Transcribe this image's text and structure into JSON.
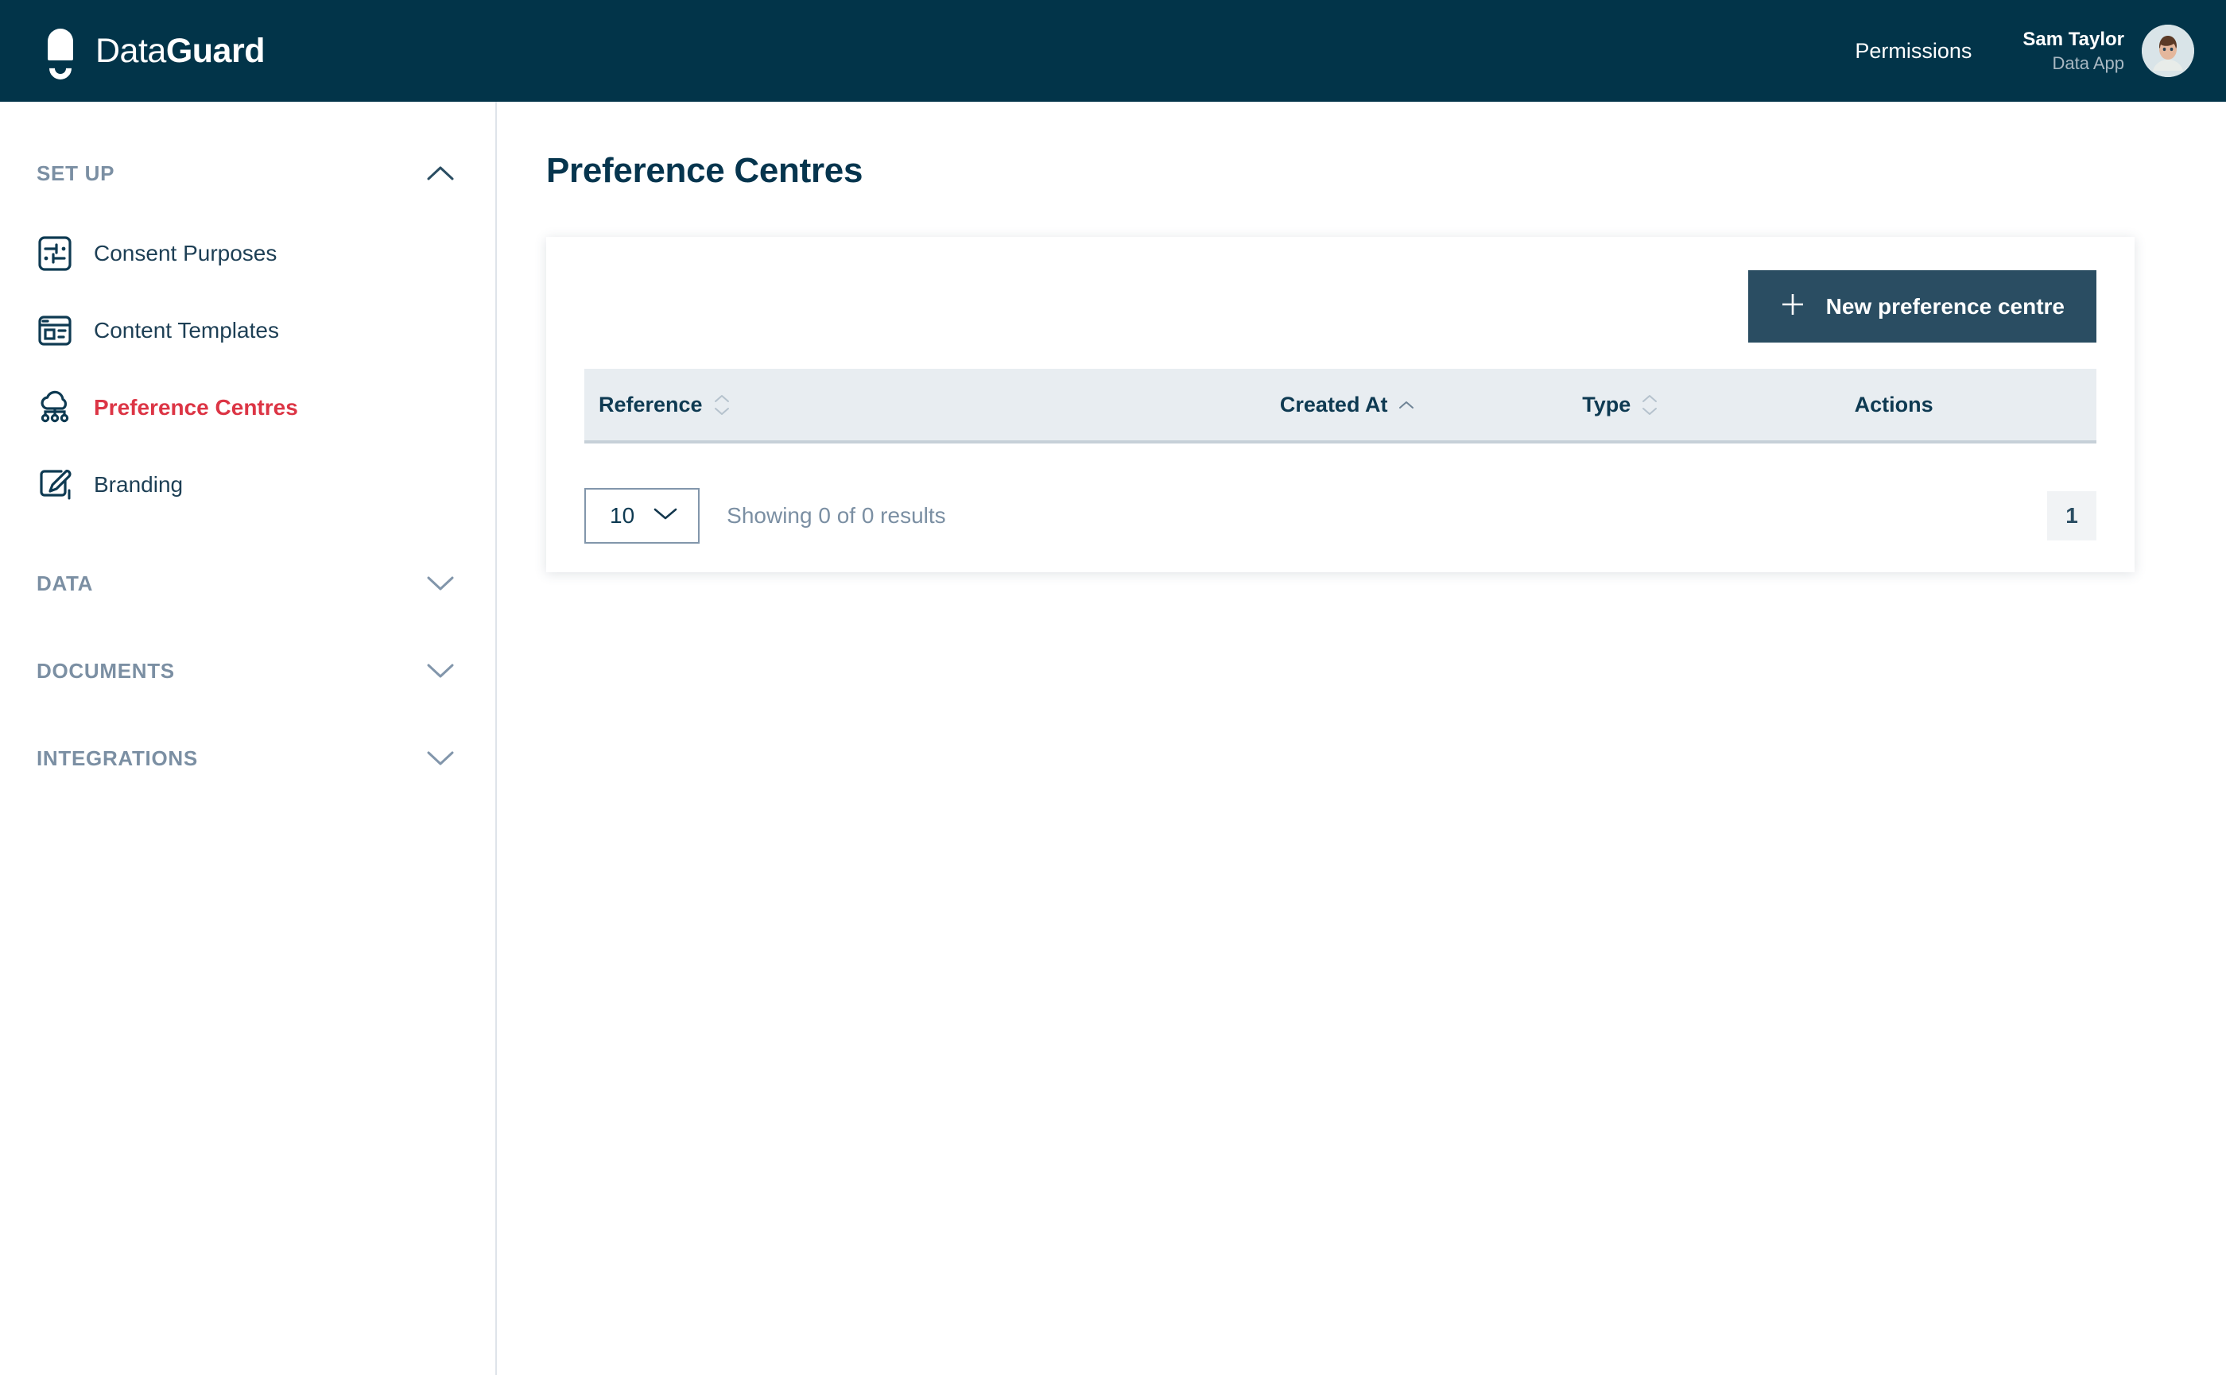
{
  "app": {
    "brand_light": "Data",
    "brand_bold": "Guard",
    "logo_icon": "dataguard-shield-logo"
  },
  "topbar": {
    "permissions_label": "Permissions",
    "user_name": "Sam Taylor",
    "user_role": "Data App",
    "avatar_icon": "user-avatar",
    "background_color": "#023449"
  },
  "sidebar": {
    "sections": [
      {
        "title": "SET UP",
        "expanded": true,
        "chevron_icon": "chevron-up-icon",
        "items": [
          {
            "label": "Consent Purposes",
            "icon": "sliders-square-icon",
            "active": false
          },
          {
            "label": "Content Templates",
            "icon": "layout-window-icon",
            "active": false
          },
          {
            "label": "Preference Centres",
            "icon": "cloud-network-icon",
            "active": true
          },
          {
            "label": "Branding",
            "icon": "paintbrush-square-icon",
            "active": false
          }
        ]
      },
      {
        "title": "DATA",
        "expanded": false,
        "chevron_icon": "chevron-down-icon",
        "items": []
      },
      {
        "title": "DOCUMENTS",
        "expanded": false,
        "chevron_icon": "chevron-down-icon",
        "items": []
      },
      {
        "title": "INTEGRATIONS",
        "expanded": false,
        "chevron_icon": "chevron-down-icon",
        "items": []
      }
    ],
    "active_color": "#dc3545",
    "label_color": "#1d3f55",
    "section_color": "#7b8fa3"
  },
  "main": {
    "page_title": "Preference Centres",
    "new_button": {
      "label": "New preference centre",
      "icon": "plus-icon",
      "background_color": "#2a4d62"
    },
    "table": {
      "columns": [
        {
          "label": "Reference",
          "sortable": true,
          "sort_state": "none"
        },
        {
          "label": "Created At",
          "sortable": true,
          "sort_state": "asc"
        },
        {
          "label": "Type",
          "sortable": true,
          "sort_state": "none"
        },
        {
          "label": "Actions",
          "sortable": false,
          "sort_state": "none"
        }
      ],
      "rows": []
    },
    "footer": {
      "page_size_value": "10",
      "page_size_chevron": "chevron-down-icon",
      "showing_text": "Showing 0 of 0 results",
      "pages": [
        "1"
      ],
      "current_page": "1"
    }
  }
}
